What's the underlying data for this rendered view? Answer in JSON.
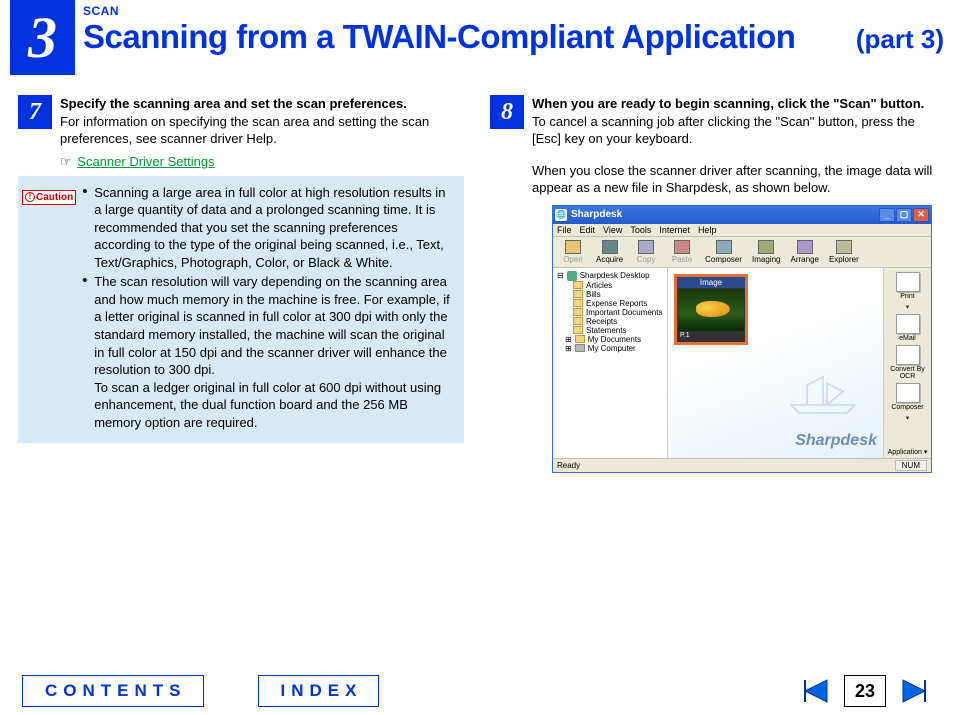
{
  "header": {
    "chapter_number": "3",
    "breadcrumb": "SCAN",
    "title": "Scanning from a TWAIN-Compliant Application",
    "part": "(part 3)"
  },
  "step7": {
    "number": "7",
    "title": "Specify the scanning area and set the scan preferences.",
    "desc": "For information on specifying the scan area and setting the scan preferences, see scanner driver Help.",
    "link_icon": "☞",
    "link_text": "Scanner Driver Settings",
    "caution_label": "Caution",
    "bullets": [
      "Scanning a large area in full color at high resolution results in a large quantity of data and a prolonged scanning time. It is recommended that you set the scanning preferences according to the type of the original being scanned, i.e., Text, Text/Graphics, Photograph, Color, or Black & White.",
      "The scan resolution will vary depending on the scanning area and how much memory in the machine is free. For example, if a letter original is scanned in full color at 300 dpi with only the standard memory installed, the machine will scan the original in full color at 150 dpi and the scanner driver will enhance the resolution to 300 dpi.\nTo scan a ledger original in full color at 600 dpi without using enhancement, the dual function board and the 256 MB memory option are required."
    ]
  },
  "step8": {
    "number": "8",
    "title": "When you are ready to begin scanning, click the \"Scan\" button.",
    "desc": "To cancel a scanning job after clicking the \"Scan\" button, press the [Esc] key on your keyboard.",
    "extra": "When you close the scanner driver after scanning, the image data will appear as a new file in Sharpdesk, as shown below."
  },
  "sharpdesk": {
    "title": "Sharpdesk",
    "menu": [
      "File",
      "Edit",
      "View",
      "Tools",
      "Internet",
      "Help"
    ],
    "toolbar": [
      {
        "label": "Open",
        "cls": "open",
        "disabled": true
      },
      {
        "label": "Acquire",
        "cls": "acq"
      },
      {
        "label": "Copy",
        "cls": "copy",
        "disabled": true
      },
      {
        "label": "Paste",
        "cls": "del",
        "disabled": true
      },
      {
        "label": "Composer",
        "cls": "comp"
      },
      {
        "label": "Imaging",
        "cls": "img"
      },
      {
        "label": "Arrange",
        "cls": "arr"
      },
      {
        "label": "Explorer",
        "cls": "exp"
      }
    ],
    "tree_root": "Sharpdesk Desktop",
    "tree_children": [
      "Articles",
      "Bills",
      "Expense Reports",
      "Important Documents",
      "Receipts",
      "Statements"
    ],
    "tree_extra": [
      "My Documents",
      "My Computer"
    ],
    "thumb_title": "Image",
    "thumb_count": "P.1",
    "watermark": "Sharpdesk",
    "dock": [
      "Print",
      "eMail",
      "Convert By OCR",
      "Composer"
    ],
    "dock_app_label": "Application",
    "status_left": "Ready",
    "status_right": "NUM"
  },
  "footer": {
    "contents": "CONTENTS",
    "index": "INDEX",
    "page": "23"
  }
}
